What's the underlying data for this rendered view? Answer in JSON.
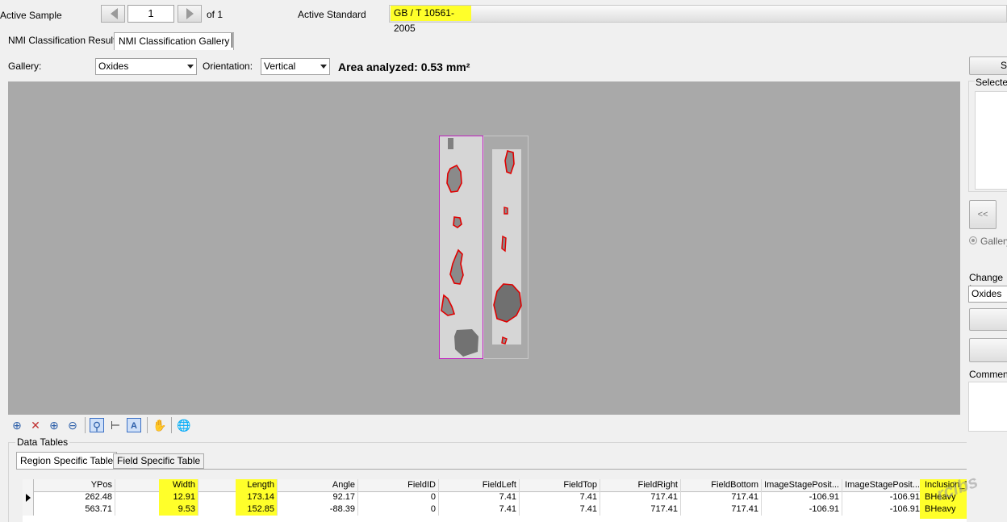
{
  "header": {
    "active_sample_label": "Active Sample",
    "page_value": "1",
    "page_of": "of 1",
    "active_standard_label": "Active Standard",
    "active_standard_value": "GB / T 10561-2005"
  },
  "tabs": [
    {
      "label": "NMI Classification Results",
      "active": false
    },
    {
      "label": "NMI Classification Gallery",
      "active": true
    }
  ],
  "gallery": {
    "gallery_label": "Gallery:",
    "gallery_value": "Oxides",
    "orientation_label": "Orientation:",
    "orientation_value": "Vertical",
    "area_text": "Area analyzed: 0.53 mm²"
  },
  "toolbar_icons": [
    "zoom-fit-icon",
    "zoom-cancel-icon",
    "zoom-in-icon",
    "zoom-out-icon",
    "magnify-icon",
    "measure-icon",
    "annotate-icon",
    "pan-hand-icon",
    "globe-icon"
  ],
  "data_tables": {
    "label": "Data Tables",
    "tabs": [
      {
        "label": "Region Specific Table",
        "active": true
      },
      {
        "label": "Field Specific Table",
        "active": false
      }
    ],
    "columns": [
      "YPos",
      "Width",
      "Length",
      "Angle",
      "FieldID",
      "FieldLeft",
      "FieldTop",
      "FieldRight",
      "FieldBottom",
      "ImageStagePosit...",
      "ImageStagePosit...",
      "Inclusion_Type"
    ],
    "highlighted_columns": [
      "Width",
      "Length",
      "Inclusion_Type"
    ],
    "rows": [
      [
        "262.48",
        "12.91",
        "173.14",
        "92.17",
        "0",
        "7.41",
        "7.41",
        "717.41",
        "717.41",
        "-106.91",
        "-106.91",
        "BHeavy"
      ],
      [
        "563.71",
        "9.53",
        "152.85",
        "-88.39",
        "0",
        "7.41",
        "7.41",
        "717.41",
        "717.41",
        "-106.91",
        "-106.91",
        "BHeavy"
      ]
    ]
  },
  "right_panel": {
    "top_button": "S",
    "selected_label": "Selected",
    "back_button": "<<",
    "gallery_radio": "Gallery",
    "change_label": "Change In",
    "change_value": "Oxides",
    "comment_label": "Comment:"
  },
  "watermark": "rcibs"
}
